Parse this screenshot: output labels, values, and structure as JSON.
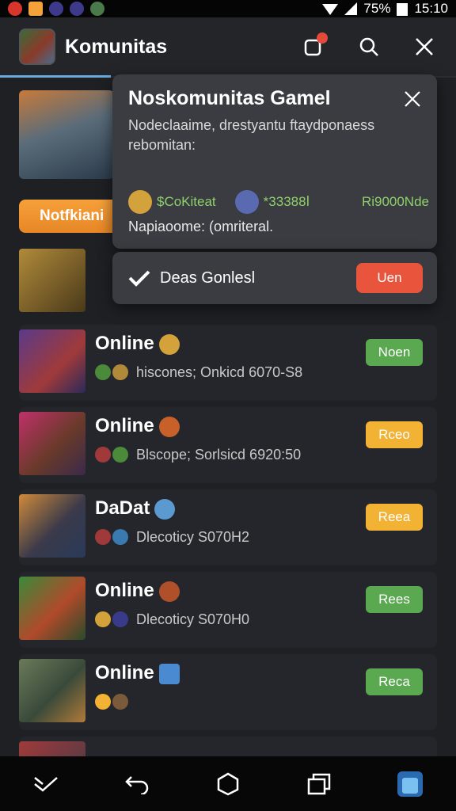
{
  "status_bar": {
    "battery": "75%",
    "time": "15:10"
  },
  "app": {
    "title": "Komunitas"
  },
  "header_icons": {
    "notifications": "notification-icon",
    "search": "search-icon",
    "close": "close-icon"
  },
  "hero": {
    "notif_pill": "Notfkiani"
  },
  "popup": {
    "title": "Noskomunitas Gamel",
    "description": "Nodeclaaime, drestyantu ftaydponaess rebomitan:",
    "stats": [
      {
        "label": "$CoKiteat"
      },
      {
        "label": "*33388ⅼ"
      },
      {
        "label": "Ri9000Nde"
      }
    ],
    "footer": "Napiaoome: (omriteral."
  },
  "confirm": {
    "label": "Deas Gonlesl",
    "button": "Uen"
  },
  "rows": [
    {
      "name": "Online",
      "sub": "hiscones; Onkicd 6070-S8",
      "tag": "Noen",
      "tag_color": "green"
    },
    {
      "name": "Online",
      "sub": "Blscope; Sorlsicd 6920:50",
      "tag": "Rceo",
      "tag_color": "yellow"
    },
    {
      "name": "DaDat",
      "sub": "Dlecoticy S070H2",
      "tag": "Reea",
      "tag_color": "yellow"
    },
    {
      "name": "Online",
      "sub": "Dlecoticy S070H0",
      "tag": "Rees",
      "tag_color": "green"
    },
    {
      "name": "Online",
      "sub": "",
      "tag": "Reca",
      "tag_color": "green"
    }
  ],
  "colors": {
    "accent_orange": "#f2a23a",
    "green": "#5aa84f",
    "yellow": "#f2b234",
    "red": "#e8553c"
  }
}
